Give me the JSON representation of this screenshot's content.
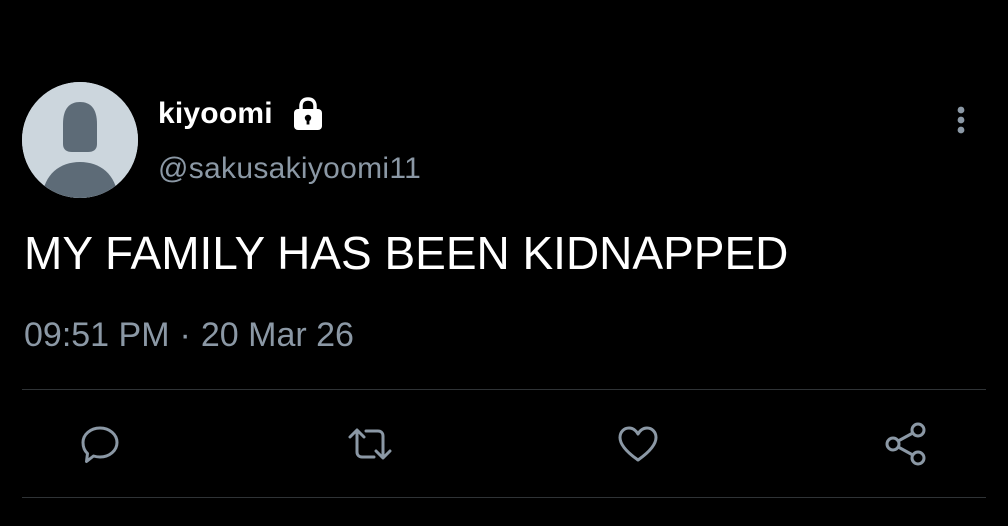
{
  "tweet": {
    "author": {
      "display_name": "kiyoomi",
      "handle": "@sakusakiyoomi11",
      "protected_icon": "lock-icon",
      "avatar_icon": "default-avatar-icon"
    },
    "text": "MY FAMILY HAS BEEN KIDNAPPED",
    "time": "09:51 PM",
    "separator": "·",
    "date": "20 Mar 26"
  },
  "actions": {
    "more_icon": "more-vertical-icon",
    "reply_icon": "reply-icon",
    "retweet_icon": "retweet-icon",
    "like_icon": "heart-icon",
    "share_icon": "share-icon"
  },
  "colors": {
    "background": "#000000",
    "primary_text": "#ffffff",
    "secondary_text": "#8b98a5",
    "divider": "#2f3336",
    "avatar_bg": "#ccd6dd",
    "avatar_fg": "#5d6b77"
  }
}
